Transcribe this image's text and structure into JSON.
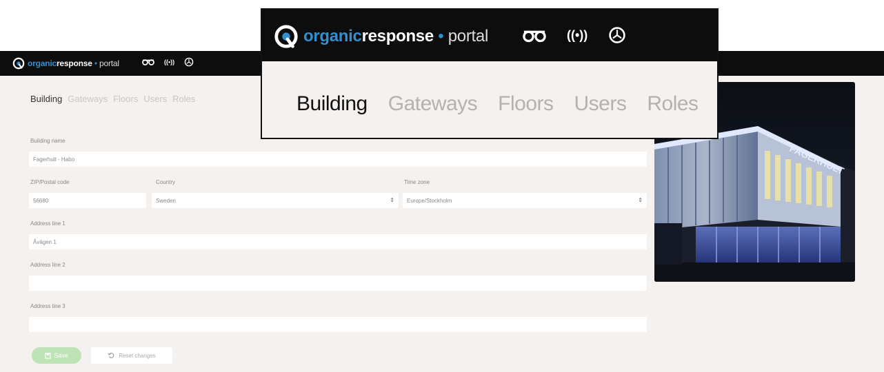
{
  "brand": {
    "organic": "organic",
    "response": "response",
    "dot": " • ",
    "portal": "portal"
  },
  "topbar_icons": [
    "glasses-icon",
    "broadcast-icon",
    "gauge-icon"
  ],
  "broadcast_glyph": "((•))",
  "tabs": {
    "building": "Building",
    "gateways": "Gateways",
    "floors": "Floors",
    "users": "Users",
    "roles": "Roles",
    "active": "Building"
  },
  "form": {
    "building_name": {
      "label": "Building name",
      "value": "Fagerhult - Habo"
    },
    "zip": {
      "label": "ZIP/Postal code",
      "value": "56680"
    },
    "country": {
      "label": "Country",
      "value": "Sweden"
    },
    "timezone": {
      "label": "Time zone",
      "value": "Europe/Stockholm"
    },
    "address1": {
      "label": "Address line 1",
      "value": "Åvägen 1"
    },
    "address2": {
      "label": "Address line 2",
      "value": ""
    },
    "address3": {
      "label": "Address line 3",
      "value": ""
    },
    "select_arrow": "⇕"
  },
  "buttons": {
    "save": "Save",
    "reset": "Reset changes"
  },
  "colors": {
    "accent": "#2f8fcf",
    "topbar": "#0d0d0d",
    "save_button": "#bde3b6",
    "background": "#f4f1ef"
  }
}
